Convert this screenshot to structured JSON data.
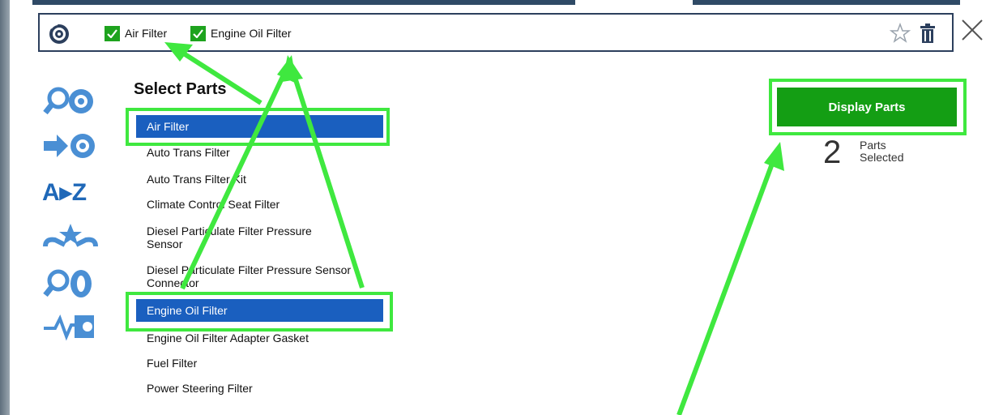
{
  "selection_bar": {
    "chips": [
      {
        "label": "Air Filter",
        "checked": true
      },
      {
        "label": "Engine Oil Filter",
        "checked": true
      }
    ],
    "icons": [
      "brake-rotor-icon",
      "star-icon",
      "trash-icon"
    ],
    "close_icon": "close-icon"
  },
  "rail": {
    "icons": [
      "search-brake-icon",
      "arrow-brake-icon",
      "a-to-z-icon",
      "wrench-star-icon",
      "search-tire-icon",
      "engine-diagnostic-icon"
    ],
    "az_text": "A▸Z"
  },
  "parts_list": {
    "title": "Select Parts",
    "items": [
      {
        "label": "Air Filter",
        "selected": true
      },
      {
        "label": "Auto Trans Filter",
        "selected": false
      },
      {
        "label": "Auto Trans Filter Kit",
        "selected": false
      },
      {
        "label": "Climate Control Seat Filter",
        "selected": false
      },
      {
        "label": "Diesel Particulate Filter Pressure Sensor",
        "selected": false
      },
      {
        "label": "Diesel Particulate Filter Pressure Sensor Connector",
        "selected": false
      },
      {
        "label": "Engine Oil Filter",
        "selected": true
      },
      {
        "label": "Engine Oil Filter Adapter Gasket",
        "selected": false
      },
      {
        "label": "Fuel Filter",
        "selected": false
      },
      {
        "label": "Power Steering Filter",
        "selected": false
      }
    ]
  },
  "action": {
    "button_label": "Display Parts",
    "count": "2",
    "count_label_1": "Parts",
    "count_label_2": "Selected"
  },
  "colors": {
    "accent_blue": "#1a5fbf",
    "button_green": "#149e14",
    "annotation_green": "#3fe83f",
    "icon_blue": "#4a8fd4"
  }
}
